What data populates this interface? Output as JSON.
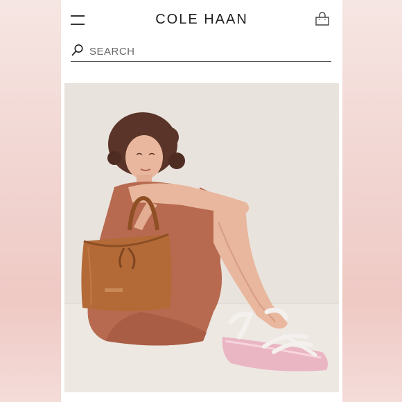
{
  "header": {
    "brand": "COLE HAAN",
    "menu_icon": "hamburger-menu-icon",
    "bag_icon": "shopping-bag-icon"
  },
  "search": {
    "icon": "search-icon",
    "placeholder": "SEARCH"
  },
  "hero": {
    "image": "model-with-handbag-and-sandals"
  },
  "colors": {
    "brand_text": "#1f1f1f",
    "background_pink": "#f3dcd9",
    "dress": "#b76a4f",
    "handbag": "#b36a37",
    "sandal_sole": "#eab6c4"
  }
}
